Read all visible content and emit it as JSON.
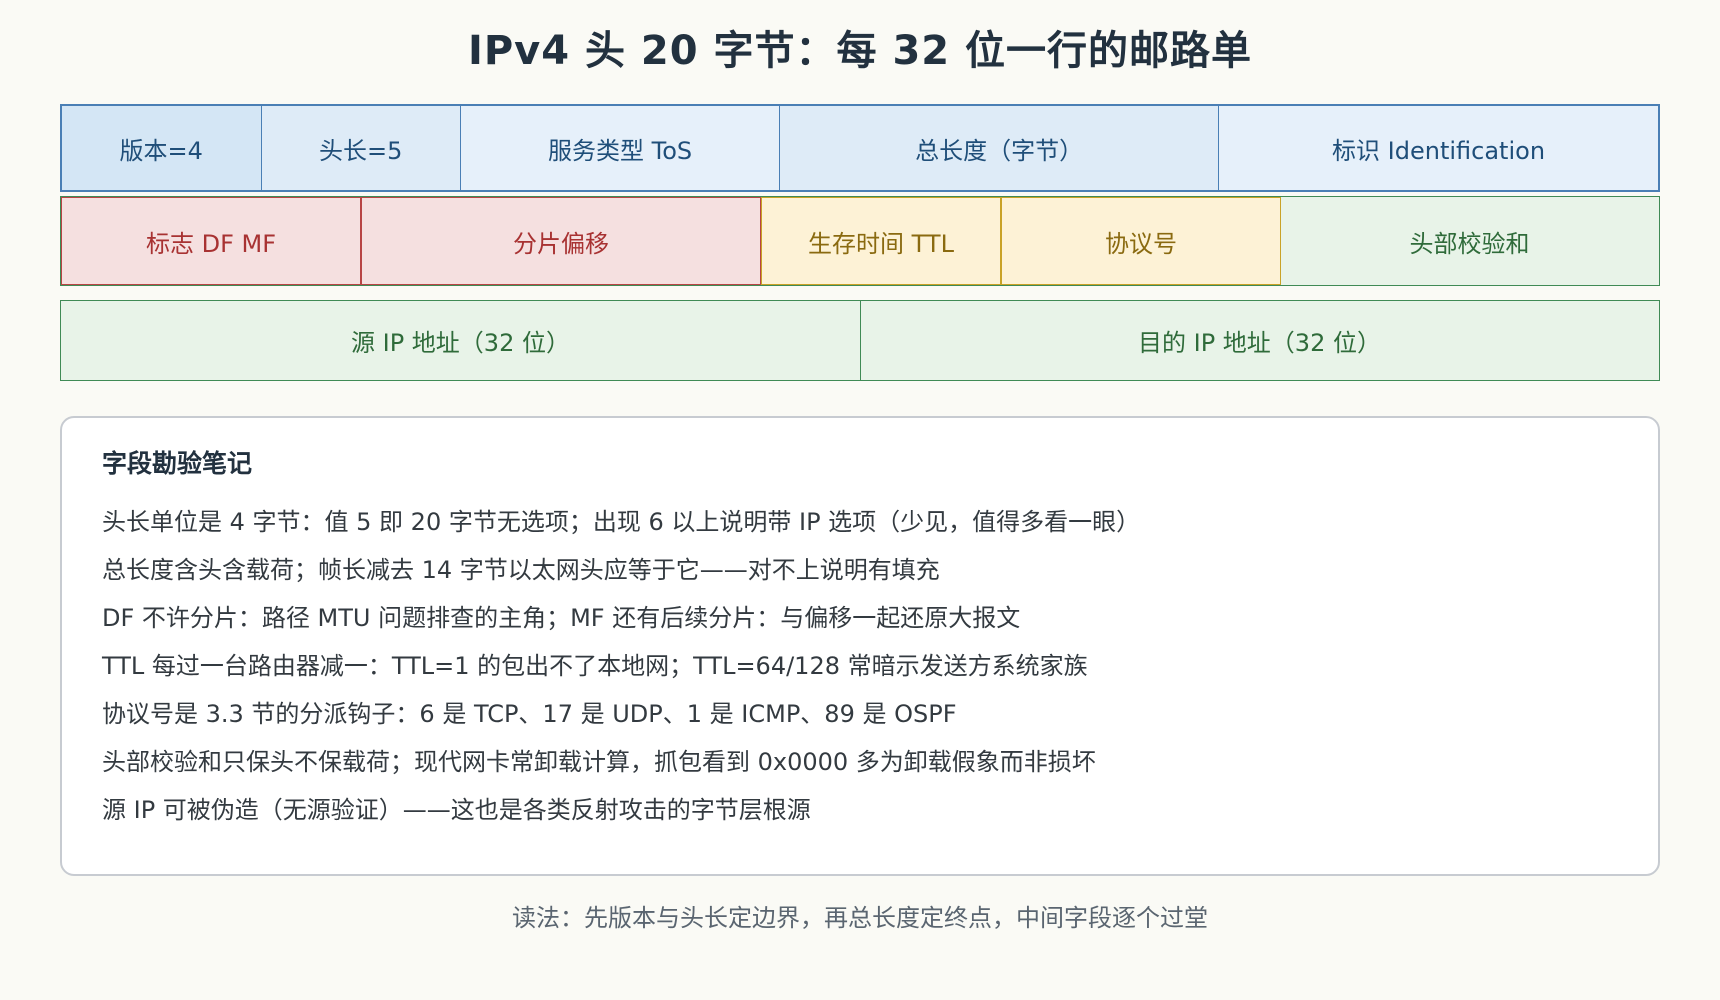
{
  "title": "IPv4 头 20 字节：每 32 位一行的邮路单",
  "row1": [
    {
      "label": "版本=4"
    },
    {
      "label": "头长=5"
    },
    {
      "label": "服务类型 ToS"
    },
    {
      "label": "总长度（字节）"
    },
    {
      "label": "标识 Identification"
    }
  ],
  "row2": [
    {
      "label": "标志 DF MF"
    },
    {
      "label": "分片偏移"
    },
    {
      "label": "生存时间 TTL"
    },
    {
      "label": "协议号"
    },
    {
      "label": "头部校验和"
    }
  ],
  "row3": [
    {
      "label": "源 IP 地址（32 位）"
    },
    {
      "label": "目的 IP 地址（32 位）"
    }
  ],
  "notes": {
    "title": "字段勘验笔记",
    "lines": [
      "头长单位是 4 字节：值 5 即 20 字节无选项；出现 6 以上说明带 IP 选项（少见，值得多看一眼）",
      "总长度含头含载荷；帧长减去 14 字节以太网头应等于它——对不上说明有填充",
      "DF 不许分片：路径 MTU 问题排查的主角；MF 还有后续分片：与偏移一起还原大报文",
      "TTL 每过一台路由器减一：TTL=1 的包出不了本地网；TTL=64/128 常暗示发送方系统家族",
      "协议号是 3.3 节的分派钩子：6 是 TCP、17 是 UDP、1 是 ICMP、89 是 OSPF",
      "头部校验和只保头不保载荷；现代网卡常卸载计算，抓包看到 0x0000 多为卸载假象而非损坏",
      "源 IP 可被伪造（无源验证）——这也是各类反射攻击的字节层根源"
    ]
  },
  "footer": "读法：先版本与头长定边界，再总长度定终点，中间字段逐个过堂"
}
